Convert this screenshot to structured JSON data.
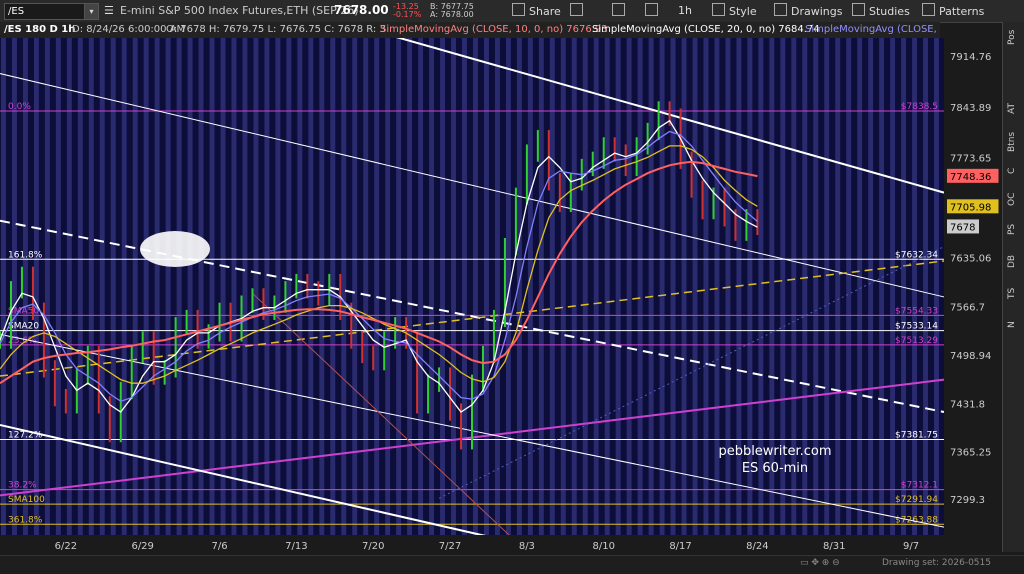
{
  "toolbar": {
    "symbol": "/ES",
    "description": "E-mini S&P 500 Index Futures,ETH (SEP 26)",
    "last_price": "7678.00",
    "change": "-13.25",
    "change_pct": "-0.17%",
    "bid": "B: 7677.75",
    "ask": "A: 7678.00",
    "share": "Share",
    "timeframe": "1h",
    "style": "Style",
    "drawings": "Drawings",
    "studies": "Studies",
    "patterns": "Patterns"
  },
  "legend": {
    "period": "/ES 180 D 1h",
    "datetime": "D: 8/24/26 6:00:00 AM",
    "ohlc": "O: 7678   H: 7679.75   L: 7676.75   C: 7678   R: 3",
    "sma10": "SimpleMovingAvg (CLOSE, 10, 0, no) 7676.93",
    "sma20": "SimpleMovingAvg (CLOSE, 20, 0, no) 7684.74",
    "sma50": "SimpleMovingAvg (CLOSE, 50, 0, no)"
  },
  "right_tabs": [
    "Pos",
    "AT",
    "Btns",
    "C",
    "OC",
    "PS",
    "DB",
    "TS",
    "N"
  ],
  "status": {
    "drawing_set": "Drawing set: 2026-0515"
  },
  "colors": {
    "background": "#0d0d3a",
    "stripe": "#44449a",
    "sma10": "#ffffff",
    "sma20": "#8080ff",
    "sma50": "#e0c020",
    "sma100": "#ff6060",
    "fib": "#d040d0",
    "level": "#ffffff"
  },
  "chart_data": {
    "type": "line",
    "title": "",
    "watermark": [
      "pebblewriter.com",
      "ES 60-min"
    ],
    "ylim": [
      7249,
      7940
    ],
    "y_ticks": [
      7914.76,
      7843.89,
      7773.65,
      7705.98,
      7635.06,
      7566.7,
      7498.94,
      7431.8,
      7365.25,
      7299.3
    ],
    "x_ticks": [
      {
        "label": "6/22",
        "t": 6
      },
      {
        "label": "6/29",
        "t": 13
      },
      {
        "label": "7/6",
        "t": 20
      },
      {
        "label": "7/13",
        "t": 27
      },
      {
        "label": "7/20",
        "t": 34
      },
      {
        "label": "7/27",
        "t": 41
      },
      {
        "label": "8/3",
        "t": 48
      },
      {
        "label": "8/10",
        "t": 55
      },
      {
        "label": "8/17",
        "t": 62
      },
      {
        "label": "8/24",
        "t": 69
      },
      {
        "label": "8/31",
        "t": 76
      },
      {
        "label": "9/7",
        "t": 83
      }
    ],
    "x_range": [
      0,
      86
    ],
    "price_labels": [
      {
        "label": "$7838.5",
        "value": 7838.5,
        "color": "#d040d0"
      },
      {
        "label": "$7632.34",
        "value": 7632.34,
        "color": "#ffffff"
      },
      {
        "label": "$7554.33",
        "value": 7554.33,
        "color": "#d040d0"
      },
      {
        "label": "$7533.14",
        "value": 7533.14,
        "color": "#ffffff"
      },
      {
        "label": "$7513.29",
        "value": 7513.29,
        "color": "#d040d0"
      },
      {
        "label": "$7381.75",
        "value": 7381.75,
        "color": "#ffffff"
      },
      {
        "label": "$7312.1",
        "value": 7312.1,
        "color": "#d040d0"
      },
      {
        "label": "$7291.94",
        "value": 7291.94,
        "color": "#e0c020"
      },
      {
        "label": "$7263.88",
        "value": 7263.88,
        "color": "#e0c020"
      }
    ],
    "left_labels": [
      {
        "label": "0.0%",
        "value": 7838.5,
        "color": "#d040d0"
      },
      {
        "label": "161.8%",
        "value": 7632.34,
        "color": "#ffffff"
      },
      {
        "label": "SMA50",
        "value": 7554.33,
        "color": "#d040d0"
      },
      {
        "label": "SMA20",
        "value": 7533.14,
        "color": "#ffffff"
      },
      {
        "label": "23.6%",
        "value": 7513.29,
        "color": "#d040d0"
      },
      {
        "label": "127.2%",
        "value": 7381.75,
        "color": "#ffffff"
      },
      {
        "label": "38.2%",
        "value": 7312.1,
        "color": "#d040d0"
      },
      {
        "label": "SMA100",
        "value": 7291.94,
        "color": "#e0c020"
      },
      {
        "label": "361.8%",
        "value": 7263.88,
        "color": "#e0c020"
      }
    ],
    "axis_badges": [
      {
        "label": "7748.36",
        "value": 7748.36,
        "bg": "#ff6060",
        "fg": "#000000"
      },
      {
        "label": "7705.98",
        "value": 7705.98,
        "bg": "#e0c020",
        "fg": "#000000"
      },
      {
        "label": "7678",
        "value": 7678,
        "bg": "#cccccc",
        "fg": "#000000"
      }
    ],
    "price_series": {
      "name": "",
      "t": [
        0,
        1,
        2,
        3,
        4,
        5,
        6,
        7,
        8,
        9,
        10,
        11,
        12,
        13,
        14,
        15,
        16,
        17,
        18,
        19,
        20,
        21,
        22,
        23,
        24,
        25,
        26,
        27,
        28,
        29,
        30,
        31,
        32,
        33,
        34,
        35,
        36,
        37,
        38,
        39,
        40,
        41,
        42,
        43,
        44,
        45,
        46,
        47,
        48,
        49,
        50,
        51,
        52,
        53,
        54,
        55,
        56,
        57,
        58,
        59,
        60,
        61,
        62,
        63,
        64,
        65,
        66,
        67,
        68,
        69
      ],
      "close": [
        7520,
        7590,
        7610,
        7560,
        7480,
        7440,
        7430,
        7470,
        7500,
        7430,
        7390,
        7450,
        7500,
        7520,
        7470,
        7480,
        7540,
        7550,
        7520,
        7530,
        7560,
        7530,
        7570,
        7580,
        7560,
        7570,
        7590,
        7600,
        7590,
        7580,
        7600,
        7560,
        7520,
        7500,
        7490,
        7520,
        7540,
        7520,
        7430,
        7460,
        7470,
        7420,
        7380,
        7460,
        7500,
        7550,
        7650,
        7720,
        7780,
        7800,
        7740,
        7710,
        7740,
        7760,
        7770,
        7790,
        7780,
        7760,
        7790,
        7810,
        7840,
        7830,
        7770,
        7730,
        7700,
        7720,
        7690,
        7670,
        7690,
        7678
      ]
    },
    "series": [
      {
        "name": "SMA10",
        "color": "#ffffff",
        "values": [
          7520,
          7560,
          7585,
          7580,
          7550,
          7510,
          7470,
          7450,
          7460,
          7450,
          7430,
          7420,
          7440,
          7470,
          7490,
          7490,
          7500,
          7520,
          7530,
          7530,
          7540,
          7545,
          7550,
          7560,
          7565,
          7565,
          7575,
          7585,
          7590,
          7590,
          7590,
          7580,
          7560,
          7540,
          7520,
          7510,
          7515,
          7520,
          7490,
          7470,
          7460,
          7440,
          7420,
          7430,
          7450,
          7490,
          7560,
          7640,
          7710,
          7760,
          7775,
          7760,
          7740,
          7745,
          7760,
          7770,
          7780,
          7775,
          7780,
          7795,
          7815,
          7825,
          7800,
          7770,
          7745,
          7725,
          7710,
          7695,
          7685,
          7677
        ]
      },
      {
        "name": "SMA20",
        "color": "#8080ff",
        "values": [
          7515,
          7545,
          7565,
          7570,
          7555,
          7530,
          7500,
          7480,
          7470,
          7460,
          7445,
          7435,
          7440,
          7455,
          7470,
          7480,
          7490,
          7505,
          7515,
          7520,
          7530,
          7538,
          7545,
          7552,
          7558,
          7562,
          7568,
          7575,
          7580,
          7582,
          7584,
          7578,
          7565,
          7550,
          7535,
          7522,
          7518,
          7516,
          7500,
          7485,
          7470,
          7455,
          7440,
          7438,
          7445,
          7470,
          7520,
          7580,
          7650,
          7710,
          7745,
          7755,
          7752,
          7750,
          7755,
          7762,
          7770,
          7772,
          7778,
          7788,
          7800,
          7810,
          7805,
          7790,
          7770,
          7750,
          7730,
          7712,
          7698,
          7685
        ]
      },
      {
        "name": "SMA50",
        "color": "#e0c020",
        "values": [
          7480,
          7500,
          7515,
          7525,
          7530,
          7525,
          7515,
          7505,
          7495,
          7485,
          7475,
          7465,
          7460,
          7460,
          7465,
          7470,
          7478,
          7485,
          7492,
          7500,
          7508,
          7515,
          7522,
          7530,
          7536,
          7542,
          7548,
          7555,
          7560,
          7565,
          7568,
          7568,
          7564,
          7558,
          7550,
          7542,
          7536,
          7530,
          7520,
          7510,
          7500,
          7488,
          7475,
          7466,
          7462,
          7468,
          7490,
          7530,
          7590,
          7645,
          7690,
          7715,
          7728,
          7735,
          7742,
          7750,
          7758,
          7763,
          7768,
          7774,
          7782,
          7790,
          7790,
          7785,
          7775,
          7760,
          7742,
          7728,
          7715,
          7706
        ]
      },
      {
        "name": "SMA100",
        "color": "#ff6060",
        "values": [
          7460,
          7470,
          7480,
          7490,
          7495,
          7498,
          7500,
          7502,
          7503,
          7505,
          7507,
          7510,
          7512,
          7515,
          7518,
          7520,
          7524,
          7528,
          7532,
          7536,
          7540,
          7544,
          7548,
          7552,
          7556,
          7558,
          7560,
          7562,
          7563,
          7563,
          7562,
          7560,
          7556,
          7552,
          7548,
          7544,
          7540,
          7536,
          7530,
          7524,
          7518,
          7510,
          7500,
          7492,
          7488,
          7490,
          7500,
          7520,
          7548,
          7580,
          7612,
          7640,
          7664,
          7684,
          7700,
          7714,
          7726,
          7736,
          7744,
          7752,
          7758,
          7763,
          7766,
          7768,
          7766,
          7762,
          7758,
          7754,
          7751,
          7748
        ]
      }
    ],
    "lines": [
      {
        "name": "upper-channel",
        "color": "#ffffff",
        "width": 2,
        "dash": "",
        "t0": -12,
        "v0": 8150,
        "t1": 86,
        "v1": 7725
      },
      {
        "name": "upper-channel-thin",
        "color": "#ffffff",
        "width": 1,
        "dash": "",
        "t0": -4,
        "v0": 7905,
        "t1": 86,
        "v1": 7580
      },
      {
        "name": "dashed-trend",
        "color": "#ffffff",
        "width": 2,
        "dash": "10,6",
        "t0": 0,
        "v0": 7686,
        "t1": 86,
        "v1": 7420
      },
      {
        "name": "yellow-dashed",
        "color": "#e0c020",
        "width": 1.5,
        "dash": "8,5",
        "t0": 0,
        "v0": 7470,
        "t1": 86,
        "v1": 7630
      },
      {
        "name": "magenta-rising",
        "color": "#d040d0",
        "width": 2,
        "dash": "",
        "t0": 0,
        "v0": 7304,
        "t1": 86,
        "v1": 7465
      },
      {
        "name": "lower-white",
        "color": "#ffffff",
        "width": 2,
        "dash": "",
        "t0": 0,
        "v0": 7402,
        "t1": 45,
        "v1": 7245
      },
      {
        "name": "lower-thin",
        "color": "#ffffff",
        "width": 1,
        "dash": "",
        "t0": 0,
        "v0": 7528,
        "t1": 86,
        "v1": 7260
      },
      {
        "name": "brown-fan",
        "color": "#b05050",
        "width": 1,
        "dash": "",
        "t0": 23,
        "v0": 7585,
        "t1": 47,
        "v1": 7240
      },
      {
        "name": "dotted-rising",
        "color": "#5060c0",
        "width": 1,
        "dash": "2,3",
        "t0": 40,
        "v0": 7300,
        "t1": 86,
        "v1": 7650
      }
    ]
  }
}
